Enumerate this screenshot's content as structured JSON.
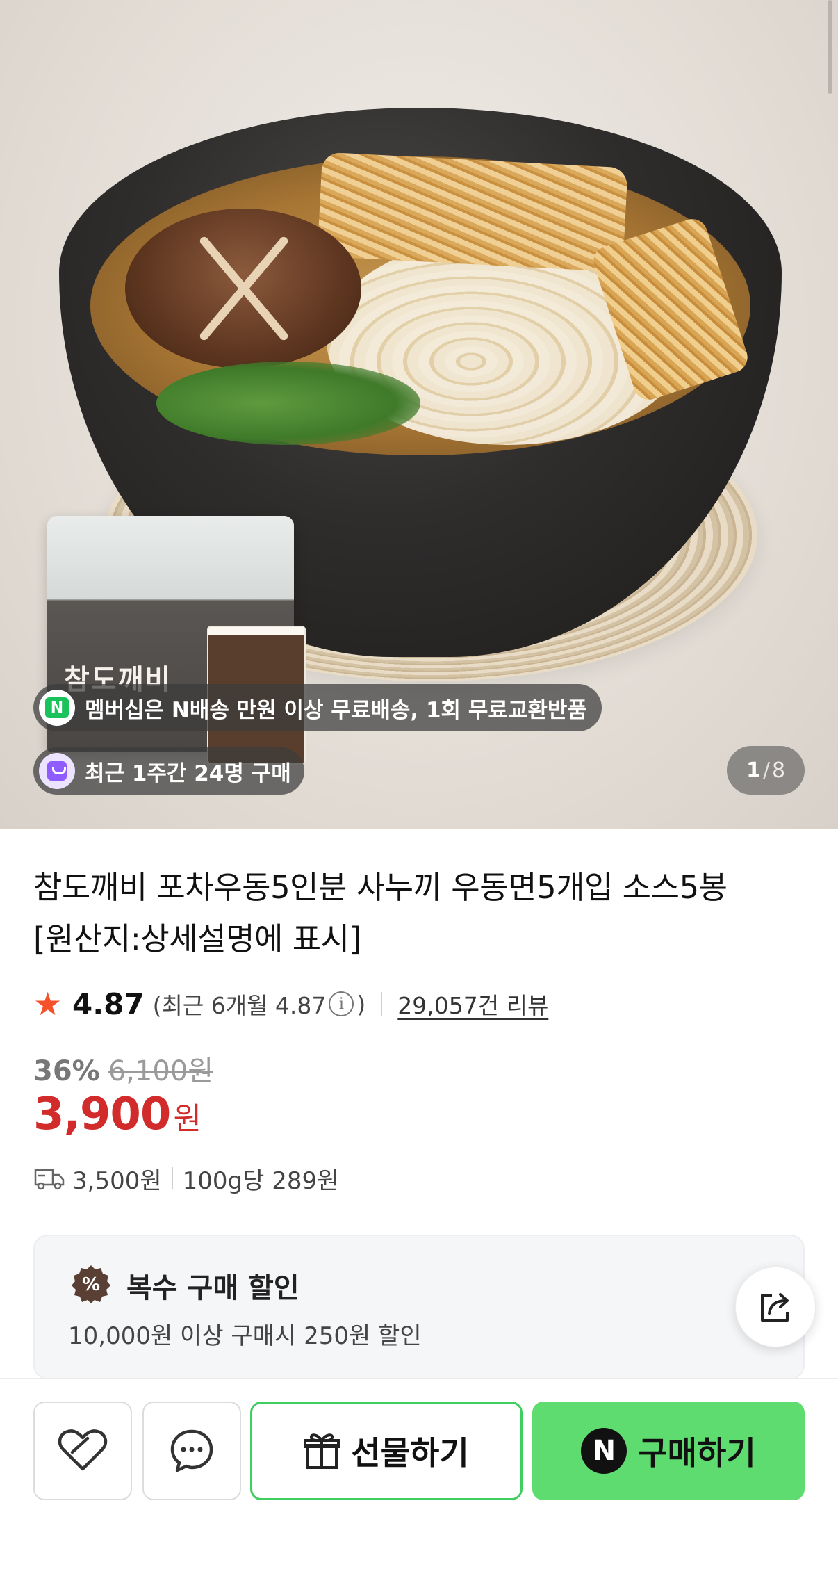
{
  "hero": {
    "pack_label": "참도깨비",
    "shipping_badge": "N",
    "shipping_text": "멤버십은 N배송 만원 이상 무료배송, 1회 무료교환반품",
    "recent_text": "최근 1주간 24명 구매",
    "pager_current": "1",
    "pager_sep": "/",
    "pager_total": "8"
  },
  "product": {
    "title_line1": "참도깨비 포차우동5인분 사누끼 우동면5개입 소스5봉",
    "title_line2": "[원산지:상세설명에 표시]",
    "rating": "4.87",
    "rating_recent": "(최근 6개월 4.87",
    "rating_recent_close": ")",
    "info_icon": "i",
    "review_count": "29,057건 리뷰",
    "discount": "36%",
    "original_price": "6,100원",
    "price": "3,900",
    "price_unit": "원",
    "shipping_fee": "3,500원",
    "unit_price": "100g당 289원"
  },
  "promo": {
    "badge": "%",
    "title": "복수 구매 할인",
    "description": "10,000원 이상 구매시 250원 할인"
  },
  "bottom_bar": {
    "gift_label": "선물하기",
    "buy_badge": "N",
    "buy_label": "구매하기"
  },
  "colors": {
    "accent_green": "#5fdc6f",
    "price_red": "#d22b2b",
    "star": "#f5522b"
  },
  "icons": [
    "star-icon",
    "info-icon",
    "truck-icon",
    "share-icon",
    "heart-icon",
    "chat-icon",
    "gift-icon",
    "naver-n-icon",
    "shopping-bag-icon"
  ]
}
